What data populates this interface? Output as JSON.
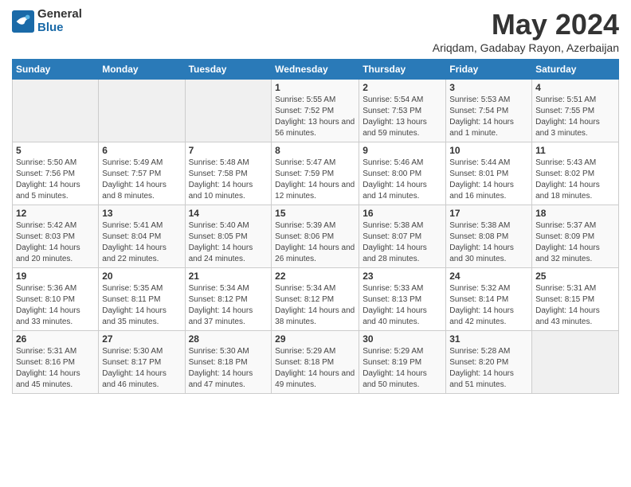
{
  "logo": {
    "general": "General",
    "blue": "Blue"
  },
  "header": {
    "month_title": "May 2024",
    "location": "Ariqdam, Gadabay Rayon, Azerbaijan"
  },
  "weekdays": [
    "Sunday",
    "Monday",
    "Tuesday",
    "Wednesday",
    "Thursday",
    "Friday",
    "Saturday"
  ],
  "weeks": [
    [
      {
        "day": "",
        "info": ""
      },
      {
        "day": "",
        "info": ""
      },
      {
        "day": "",
        "info": ""
      },
      {
        "day": "1",
        "info": "Sunrise: 5:55 AM\nSunset: 7:52 PM\nDaylight: 13 hours and 56 minutes."
      },
      {
        "day": "2",
        "info": "Sunrise: 5:54 AM\nSunset: 7:53 PM\nDaylight: 13 hours and 59 minutes."
      },
      {
        "day": "3",
        "info": "Sunrise: 5:53 AM\nSunset: 7:54 PM\nDaylight: 14 hours and 1 minute."
      },
      {
        "day": "4",
        "info": "Sunrise: 5:51 AM\nSunset: 7:55 PM\nDaylight: 14 hours and 3 minutes."
      }
    ],
    [
      {
        "day": "5",
        "info": "Sunrise: 5:50 AM\nSunset: 7:56 PM\nDaylight: 14 hours and 5 minutes."
      },
      {
        "day": "6",
        "info": "Sunrise: 5:49 AM\nSunset: 7:57 PM\nDaylight: 14 hours and 8 minutes."
      },
      {
        "day": "7",
        "info": "Sunrise: 5:48 AM\nSunset: 7:58 PM\nDaylight: 14 hours and 10 minutes."
      },
      {
        "day": "8",
        "info": "Sunrise: 5:47 AM\nSunset: 7:59 PM\nDaylight: 14 hours and 12 minutes."
      },
      {
        "day": "9",
        "info": "Sunrise: 5:46 AM\nSunset: 8:00 PM\nDaylight: 14 hours and 14 minutes."
      },
      {
        "day": "10",
        "info": "Sunrise: 5:44 AM\nSunset: 8:01 PM\nDaylight: 14 hours and 16 minutes."
      },
      {
        "day": "11",
        "info": "Sunrise: 5:43 AM\nSunset: 8:02 PM\nDaylight: 14 hours and 18 minutes."
      }
    ],
    [
      {
        "day": "12",
        "info": "Sunrise: 5:42 AM\nSunset: 8:03 PM\nDaylight: 14 hours and 20 minutes."
      },
      {
        "day": "13",
        "info": "Sunrise: 5:41 AM\nSunset: 8:04 PM\nDaylight: 14 hours and 22 minutes."
      },
      {
        "day": "14",
        "info": "Sunrise: 5:40 AM\nSunset: 8:05 PM\nDaylight: 14 hours and 24 minutes."
      },
      {
        "day": "15",
        "info": "Sunrise: 5:39 AM\nSunset: 8:06 PM\nDaylight: 14 hours and 26 minutes."
      },
      {
        "day": "16",
        "info": "Sunrise: 5:38 AM\nSunset: 8:07 PM\nDaylight: 14 hours and 28 minutes."
      },
      {
        "day": "17",
        "info": "Sunrise: 5:38 AM\nSunset: 8:08 PM\nDaylight: 14 hours and 30 minutes."
      },
      {
        "day": "18",
        "info": "Sunrise: 5:37 AM\nSunset: 8:09 PM\nDaylight: 14 hours and 32 minutes."
      }
    ],
    [
      {
        "day": "19",
        "info": "Sunrise: 5:36 AM\nSunset: 8:10 PM\nDaylight: 14 hours and 33 minutes."
      },
      {
        "day": "20",
        "info": "Sunrise: 5:35 AM\nSunset: 8:11 PM\nDaylight: 14 hours and 35 minutes."
      },
      {
        "day": "21",
        "info": "Sunrise: 5:34 AM\nSunset: 8:12 PM\nDaylight: 14 hours and 37 minutes."
      },
      {
        "day": "22",
        "info": "Sunrise: 5:34 AM\nSunset: 8:12 PM\nDaylight: 14 hours and 38 minutes."
      },
      {
        "day": "23",
        "info": "Sunrise: 5:33 AM\nSunset: 8:13 PM\nDaylight: 14 hours and 40 minutes."
      },
      {
        "day": "24",
        "info": "Sunrise: 5:32 AM\nSunset: 8:14 PM\nDaylight: 14 hours and 42 minutes."
      },
      {
        "day": "25",
        "info": "Sunrise: 5:31 AM\nSunset: 8:15 PM\nDaylight: 14 hours and 43 minutes."
      }
    ],
    [
      {
        "day": "26",
        "info": "Sunrise: 5:31 AM\nSunset: 8:16 PM\nDaylight: 14 hours and 45 minutes."
      },
      {
        "day": "27",
        "info": "Sunrise: 5:30 AM\nSunset: 8:17 PM\nDaylight: 14 hours and 46 minutes."
      },
      {
        "day": "28",
        "info": "Sunrise: 5:30 AM\nSunset: 8:18 PM\nDaylight: 14 hours and 47 minutes."
      },
      {
        "day": "29",
        "info": "Sunrise: 5:29 AM\nSunset: 8:18 PM\nDaylight: 14 hours and 49 minutes."
      },
      {
        "day": "30",
        "info": "Sunrise: 5:29 AM\nSunset: 8:19 PM\nDaylight: 14 hours and 50 minutes."
      },
      {
        "day": "31",
        "info": "Sunrise: 5:28 AM\nSunset: 8:20 PM\nDaylight: 14 hours and 51 minutes."
      },
      {
        "day": "",
        "info": ""
      }
    ]
  ]
}
